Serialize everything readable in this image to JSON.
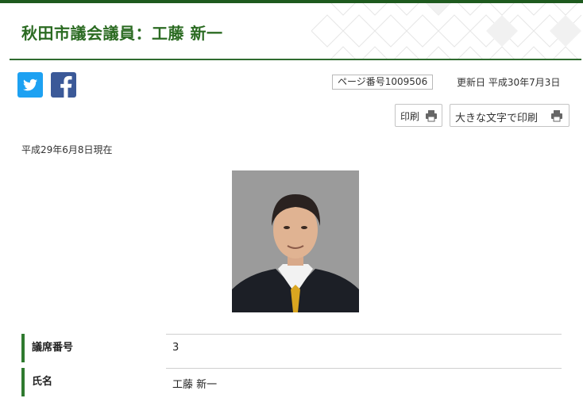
{
  "header": {
    "title": "秋田市議会議員：工藤 新一"
  },
  "social": {
    "twitter_icon": "twitter-icon",
    "facebook_icon": "facebook-icon"
  },
  "meta": {
    "page_number": "ページ番号1009506",
    "updated": "更新日 平成30年7月3日"
  },
  "print": {
    "print_label": "印刷",
    "large_print_label": "大きな文字で印刷"
  },
  "content": {
    "as_of": "平成29年6月8日現在",
    "rows": [
      {
        "label": "議席番号",
        "value": "3"
      },
      {
        "label": "氏名",
        "value": "工藤 新一"
      }
    ]
  },
  "colors": {
    "accent": "#2b6b22",
    "twitter": "#1da1f2",
    "facebook": "#3b5998"
  }
}
